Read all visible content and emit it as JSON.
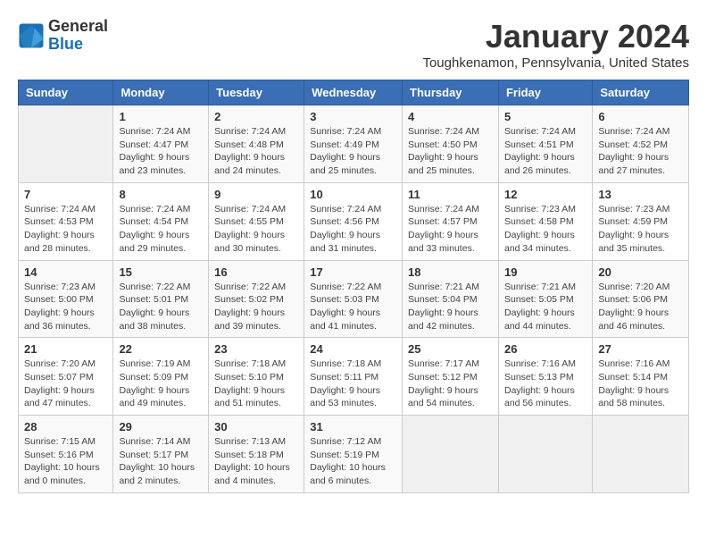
{
  "logo": {
    "general": "General",
    "blue": "Blue"
  },
  "title": "January 2024",
  "location": "Toughkenamon, Pennsylvania, United States",
  "days": [
    "Sunday",
    "Monday",
    "Tuesday",
    "Wednesday",
    "Thursday",
    "Friday",
    "Saturday"
  ],
  "weeks": [
    [
      {
        "date": "",
        "info": ""
      },
      {
        "date": "1",
        "info": "Sunrise: 7:24 AM\nSunset: 4:47 PM\nDaylight: 9 hours\nand 23 minutes."
      },
      {
        "date": "2",
        "info": "Sunrise: 7:24 AM\nSunset: 4:48 PM\nDaylight: 9 hours\nand 24 minutes."
      },
      {
        "date": "3",
        "info": "Sunrise: 7:24 AM\nSunset: 4:49 PM\nDaylight: 9 hours\nand 25 minutes."
      },
      {
        "date": "4",
        "info": "Sunrise: 7:24 AM\nSunset: 4:50 PM\nDaylight: 9 hours\nand 25 minutes."
      },
      {
        "date": "5",
        "info": "Sunrise: 7:24 AM\nSunset: 4:51 PM\nDaylight: 9 hours\nand 26 minutes."
      },
      {
        "date": "6",
        "info": "Sunrise: 7:24 AM\nSunset: 4:52 PM\nDaylight: 9 hours\nand 27 minutes."
      }
    ],
    [
      {
        "date": "7",
        "info": "Sunrise: 7:24 AM\nSunset: 4:53 PM\nDaylight: 9 hours\nand 28 minutes."
      },
      {
        "date": "8",
        "info": "Sunrise: 7:24 AM\nSunset: 4:54 PM\nDaylight: 9 hours\nand 29 minutes."
      },
      {
        "date": "9",
        "info": "Sunrise: 7:24 AM\nSunset: 4:55 PM\nDaylight: 9 hours\nand 30 minutes."
      },
      {
        "date": "10",
        "info": "Sunrise: 7:24 AM\nSunset: 4:56 PM\nDaylight: 9 hours\nand 31 minutes."
      },
      {
        "date": "11",
        "info": "Sunrise: 7:24 AM\nSunset: 4:57 PM\nDaylight: 9 hours\nand 33 minutes."
      },
      {
        "date": "12",
        "info": "Sunrise: 7:23 AM\nSunset: 4:58 PM\nDaylight: 9 hours\nand 34 minutes."
      },
      {
        "date": "13",
        "info": "Sunrise: 7:23 AM\nSunset: 4:59 PM\nDaylight: 9 hours\nand 35 minutes."
      }
    ],
    [
      {
        "date": "14",
        "info": "Sunrise: 7:23 AM\nSunset: 5:00 PM\nDaylight: 9 hours\nand 36 minutes."
      },
      {
        "date": "15",
        "info": "Sunrise: 7:22 AM\nSunset: 5:01 PM\nDaylight: 9 hours\nand 38 minutes."
      },
      {
        "date": "16",
        "info": "Sunrise: 7:22 AM\nSunset: 5:02 PM\nDaylight: 9 hours\nand 39 minutes."
      },
      {
        "date": "17",
        "info": "Sunrise: 7:22 AM\nSunset: 5:03 PM\nDaylight: 9 hours\nand 41 minutes."
      },
      {
        "date": "18",
        "info": "Sunrise: 7:21 AM\nSunset: 5:04 PM\nDaylight: 9 hours\nand 42 minutes."
      },
      {
        "date": "19",
        "info": "Sunrise: 7:21 AM\nSunset: 5:05 PM\nDaylight: 9 hours\nand 44 minutes."
      },
      {
        "date": "20",
        "info": "Sunrise: 7:20 AM\nSunset: 5:06 PM\nDaylight: 9 hours\nand 46 minutes."
      }
    ],
    [
      {
        "date": "21",
        "info": "Sunrise: 7:20 AM\nSunset: 5:07 PM\nDaylight: 9 hours\nand 47 minutes."
      },
      {
        "date": "22",
        "info": "Sunrise: 7:19 AM\nSunset: 5:09 PM\nDaylight: 9 hours\nand 49 minutes."
      },
      {
        "date": "23",
        "info": "Sunrise: 7:18 AM\nSunset: 5:10 PM\nDaylight: 9 hours\nand 51 minutes."
      },
      {
        "date": "24",
        "info": "Sunrise: 7:18 AM\nSunset: 5:11 PM\nDaylight: 9 hours\nand 53 minutes."
      },
      {
        "date": "25",
        "info": "Sunrise: 7:17 AM\nSunset: 5:12 PM\nDaylight: 9 hours\nand 54 minutes."
      },
      {
        "date": "26",
        "info": "Sunrise: 7:16 AM\nSunset: 5:13 PM\nDaylight: 9 hours\nand 56 minutes."
      },
      {
        "date": "27",
        "info": "Sunrise: 7:16 AM\nSunset: 5:14 PM\nDaylight: 9 hours\nand 58 minutes."
      }
    ],
    [
      {
        "date": "28",
        "info": "Sunrise: 7:15 AM\nSunset: 5:16 PM\nDaylight: 10 hours\nand 0 minutes."
      },
      {
        "date": "29",
        "info": "Sunrise: 7:14 AM\nSunset: 5:17 PM\nDaylight: 10 hours\nand 2 minutes."
      },
      {
        "date": "30",
        "info": "Sunrise: 7:13 AM\nSunset: 5:18 PM\nDaylight: 10 hours\nand 4 minutes."
      },
      {
        "date": "31",
        "info": "Sunrise: 7:12 AM\nSunset: 5:19 PM\nDaylight: 10 hours\nand 6 minutes."
      },
      {
        "date": "",
        "info": ""
      },
      {
        "date": "",
        "info": ""
      },
      {
        "date": "",
        "info": ""
      }
    ]
  ]
}
